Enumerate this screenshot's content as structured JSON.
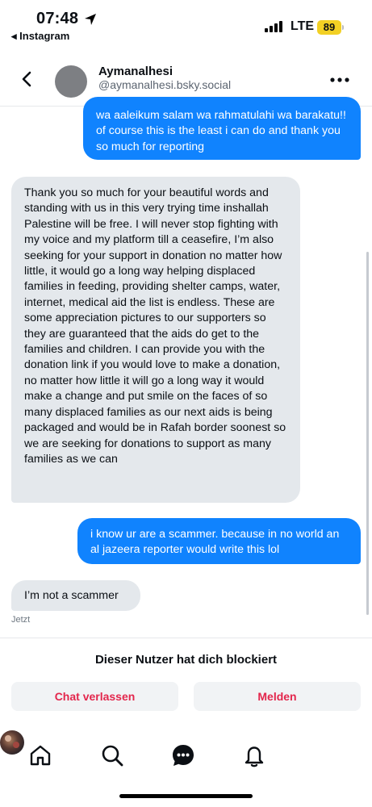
{
  "status_bar": {
    "time": "07:48",
    "back_app": "◂ Instagram",
    "network": "LTE",
    "battery": "89",
    "battery_color": "#f2d024"
  },
  "header": {
    "display_name": "Aymanalhesi",
    "handle": "@aymanalhesi.bsky.social",
    "back_icon": "chevron-left-icon",
    "more_icon": "ellipsis-icon"
  },
  "messages": [
    {
      "direction": "outgoing",
      "text": "wa aaleikum salam wa rahmatulahi wa barakatu!! of course this is the least i can do and thank you so much for reporting"
    },
    {
      "direction": "incoming",
      "text": "Thank you so much for your beautiful words and standing with us in this very trying time inshallah Palestine will be free. I will never stop fighting with my voice and my platform till a ceasefire, I’m also seeking for your support in donation no matter how little, it would go a long way helping displaced families in feeding, providing shelter camps, water, internet, medical aid the list is endless. These are some appreciation pictures to our supporters so they are guaranteed that the aids do get to the families and children. I can provide you with the donation link if you would love to make a donation, no matter how little it will go a long way it would make a change and put smile on the faces of so many displaced families as our next aids is being packaged and would be in Rafah border soonest so we are seeking for donations to support as many families as we can"
    },
    {
      "direction": "outgoing",
      "text": "i know ur are a scammer. because in no world an al jazeera reporter would write this lol"
    },
    {
      "direction": "incoming",
      "text": "I’m not a scammer"
    }
  ],
  "timestamp": "Jetzt",
  "blocked": {
    "text": "Dieser Nutzer hat dich blockiert",
    "leave_label": "Chat verlassen",
    "report_label": "Melden",
    "action_color": "#e3264c"
  },
  "colors": {
    "outgoing_bubble": "#1083fe",
    "incoming_bubble": "#e4e8ec"
  },
  "bottom_nav": {
    "items": [
      "home-icon",
      "search-icon",
      "chat-icon",
      "bell-icon",
      "profile-avatar"
    ],
    "active": "chat-icon"
  }
}
